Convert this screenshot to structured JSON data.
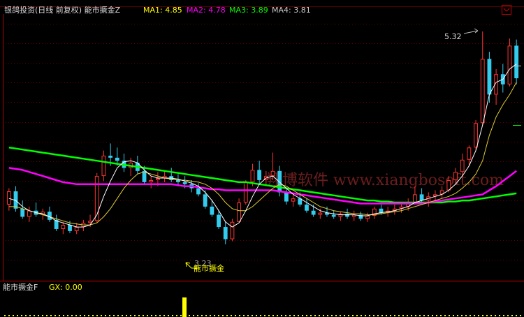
{
  "watermark": "翔博软件  www.xiangbosoft.com",
  "colors": {
    "up": "#ff3333",
    "down": "#33ccee",
    "ma1": "#ffffff",
    "ma2": "#ff00ff",
    "ma3": "#00ff00",
    "ma4": "#cccccc",
    "yellow_line": "#ddcc33",
    "title": "#dddddd",
    "signal": "#ffff00",
    "grid": "#660000"
  },
  "chart_data": {
    "type": "candlestick",
    "title": "银鸽投资(日线 前复权) 能市撅金Z",
    "legend": [
      {
        "label": "MA1:",
        "value": "4.85",
        "color": "#ffff00"
      },
      {
        "label": "MA2:",
        "value": "4.78",
        "color": "#ff00ff"
      },
      {
        "label": "MA3:",
        "value": "3.89",
        "color": "#00ff00"
      },
      {
        "label": "MA4:",
        "value": "3.81",
        "color": "#cccccc"
      }
    ],
    "sub_indicator": {
      "title": "能市撅金F",
      "label": "GX:",
      "value": "0.00",
      "color": "#ffff00"
    },
    "annotations": {
      "high_label": "5.32",
      "low_label": "3.23",
      "signal_label": "能市撅金"
    },
    "left_axis_mark": "",
    "grid_y": [
      34,
      62,
      90,
      118,
      146,
      175,
      203,
      231,
      259,
      287,
      316,
      344,
      372
    ],
    "y_range": [
      2.9,
      5.45
    ],
    "candles": [
      [
        3.62,
        3.78,
        3.56,
        3.75
      ],
      [
        3.75,
        3.8,
        3.55,
        3.58
      ],
      [
        3.58,
        3.66,
        3.48,
        3.5
      ],
      [
        3.5,
        3.6,
        3.45,
        3.56
      ],
      [
        3.56,
        3.64,
        3.5,
        3.52
      ],
      [
        3.52,
        3.58,
        3.47,
        3.55
      ],
      [
        3.55,
        3.6,
        3.45,
        3.47
      ],
      [
        3.47,
        3.52,
        3.36,
        3.38
      ],
      [
        3.38,
        3.45,
        3.33,
        3.42
      ],
      [
        3.42,
        3.46,
        3.34,
        3.36
      ],
      [
        3.36,
        3.44,
        3.33,
        3.4
      ],
      [
        3.4,
        3.47,
        3.36,
        3.44
      ],
      [
        3.44,
        3.52,
        3.4,
        3.46
      ],
      [
        3.46,
        3.93,
        3.44,
        3.9
      ],
      [
        3.9,
        4.15,
        3.85,
        4.1
      ],
      [
        4.1,
        4.22,
        4.0,
        4.08
      ],
      [
        4.08,
        4.18,
        4.0,
        4.05
      ],
      [
        4.05,
        4.12,
        3.94,
        3.98
      ],
      [
        3.98,
        4.08,
        3.9,
        4.03
      ],
      [
        4.03,
        4.1,
        3.92,
        3.95
      ],
      [
        3.95,
        4.0,
        3.82,
        3.84
      ],
      [
        3.84,
        3.9,
        3.78,
        3.86
      ],
      [
        3.86,
        3.94,
        3.8,
        3.88
      ],
      [
        3.88,
        3.95,
        3.84,
        3.9
      ],
      [
        3.9,
        3.98,
        3.84,
        3.86
      ],
      [
        3.86,
        3.92,
        3.8,
        3.84
      ],
      [
        3.84,
        3.9,
        3.78,
        3.82
      ],
      [
        3.82,
        3.86,
        3.74,
        3.78
      ],
      [
        3.78,
        3.83,
        3.7,
        3.72
      ],
      [
        3.72,
        3.76,
        3.58,
        3.6
      ],
      [
        3.6,
        3.66,
        3.5,
        3.52
      ],
      [
        3.52,
        3.56,
        3.38,
        3.4
      ],
      [
        3.4,
        3.45,
        3.23,
        3.28
      ],
      [
        3.28,
        3.48,
        3.26,
        3.45
      ],
      [
        3.45,
        3.68,
        3.44,
        3.64
      ],
      [
        3.64,
        3.86,
        3.62,
        3.84
      ],
      [
        3.84,
        4.02,
        3.8,
        3.96
      ],
      [
        3.96,
        4.05,
        3.82,
        3.86
      ],
      [
        3.86,
        3.95,
        3.8,
        3.9
      ],
      [
        3.9,
        4.13,
        3.86,
        3.95
      ],
      [
        3.95,
        4.0,
        3.7,
        3.74
      ],
      [
        3.74,
        3.78,
        3.62,
        3.65
      ],
      [
        3.65,
        3.72,
        3.6,
        3.68
      ],
      [
        3.68,
        3.74,
        3.6,
        3.62
      ],
      [
        3.62,
        3.68,
        3.54,
        3.56
      ],
      [
        3.56,
        3.62,
        3.5,
        3.52
      ],
      [
        3.52,
        3.58,
        3.48,
        3.54
      ],
      [
        3.54,
        3.6,
        3.5,
        3.52
      ],
      [
        3.52,
        3.56,
        3.48,
        3.5
      ],
      [
        3.5,
        3.55,
        3.46,
        3.53
      ],
      [
        3.53,
        3.58,
        3.48,
        3.5
      ],
      [
        3.5,
        3.56,
        3.46,
        3.52
      ],
      [
        3.52,
        3.55,
        3.46,
        3.48
      ],
      [
        3.48,
        3.54,
        3.45,
        3.51
      ],
      [
        3.51,
        3.6,
        3.48,
        3.58
      ],
      [
        3.58,
        3.62,
        3.52,
        3.54
      ],
      [
        3.54,
        3.6,
        3.5,
        3.56
      ],
      [
        3.56,
        3.62,
        3.52,
        3.58
      ],
      [
        3.58,
        3.64,
        3.54,
        3.6
      ],
      [
        3.6,
        3.68,
        3.56,
        3.64
      ],
      [
        3.64,
        3.8,
        3.62,
        3.72
      ],
      [
        3.72,
        3.78,
        3.62,
        3.66
      ],
      [
        3.66,
        3.74,
        3.6,
        3.7
      ],
      [
        3.7,
        3.76,
        3.64,
        3.72
      ],
      [
        3.72,
        3.8,
        3.68,
        3.76
      ],
      [
        3.76,
        3.9,
        3.74,
        3.86
      ],
      [
        3.86,
        3.98,
        3.82,
        3.94
      ],
      [
        3.94,
        4.12,
        3.9,
        4.06
      ],
      [
        4.06,
        4.2,
        4.0,
        4.18
      ],
      [
        4.18,
        4.45,
        4.15,
        4.42
      ],
      [
        4.42,
        5.32,
        4.4,
        5.05
      ],
      [
        5.05,
        5.12,
        4.62,
        4.7
      ],
      [
        4.7,
        4.95,
        4.6,
        4.9
      ],
      [
        4.9,
        5.0,
        4.72,
        4.8
      ],
      [
        4.8,
        5.25,
        4.78,
        5.18
      ],
      [
        5.18,
        5.24,
        4.8,
        4.86
      ]
    ],
    "ma_lines": {
      "ma3": [
        4.18,
        4.17,
        4.16,
        4.15,
        4.14,
        4.13,
        4.12,
        4.11,
        4.1,
        4.09,
        4.08,
        4.07,
        4.06,
        4.05,
        4.04,
        4.03,
        4.02,
        4.01,
        4.0,
        3.99,
        3.98,
        3.97,
        3.96,
        3.95,
        3.94,
        3.93,
        3.92,
        3.91,
        3.9,
        3.89,
        3.88,
        3.87,
        3.86,
        3.85,
        3.84,
        3.84,
        3.83,
        3.82,
        3.81,
        3.8,
        3.79,
        3.78,
        3.77,
        3.76,
        3.75,
        3.74,
        3.73,
        3.72,
        3.71,
        3.7,
        3.69,
        3.68,
        3.67,
        3.66,
        3.66,
        3.65,
        3.65,
        3.64,
        3.64,
        3.64,
        3.64,
        3.64,
        3.64,
        3.64,
        3.64,
        3.65,
        3.65,
        3.66,
        3.66,
        3.67,
        3.68,
        3.69,
        3.7,
        3.71,
        3.72,
        3.73
      ],
      "ma2": [
        3.98,
        3.97,
        3.96,
        3.94,
        3.92,
        3.9,
        3.88,
        3.86,
        3.84,
        3.83,
        3.82,
        3.82,
        3.82,
        3.82,
        3.82,
        3.82,
        3.82,
        3.82,
        3.82,
        3.82,
        3.82,
        3.82,
        3.82,
        3.82,
        3.82,
        3.81,
        3.8,
        3.8,
        3.79,
        3.78,
        3.77,
        3.77,
        3.76,
        3.76,
        3.76,
        3.76,
        3.76,
        3.76,
        3.76,
        3.76,
        3.75,
        3.74,
        3.73,
        3.72,
        3.71,
        3.7,
        3.69,
        3.68,
        3.67,
        3.66,
        3.65,
        3.64,
        3.63,
        3.63,
        3.63,
        3.63,
        3.63,
        3.63,
        3.63,
        3.63,
        3.63,
        3.63,
        3.64,
        3.65,
        3.66,
        3.67,
        3.68,
        3.69,
        3.7,
        3.71,
        3.72,
        3.76,
        3.8,
        3.85,
        3.9,
        3.95
      ],
      "ma1": [
        3.68,
        3.66,
        3.6,
        3.56,
        3.54,
        3.53,
        3.5,
        3.46,
        3.44,
        3.42,
        3.4,
        3.4,
        3.42,
        3.52,
        3.7,
        3.85,
        3.98,
        4.04,
        4.05,
        4.03,
        3.96,
        3.9,
        3.88,
        3.88,
        3.88,
        3.87,
        3.85,
        3.83,
        3.8,
        3.74,
        3.66,
        3.56,
        3.45,
        3.4,
        3.44,
        3.56,
        3.7,
        3.82,
        3.88,
        3.9,
        3.84,
        3.78,
        3.72,
        3.68,
        3.64,
        3.6,
        3.56,
        3.54,
        3.53,
        3.52,
        3.52,
        3.52,
        3.51,
        3.51,
        3.53,
        3.54,
        3.55,
        3.56,
        3.58,
        3.6,
        3.64,
        3.66,
        3.68,
        3.7,
        3.72,
        3.76,
        3.82,
        3.9,
        4.0,
        4.15,
        4.4,
        4.7,
        4.82,
        4.85,
        4.95,
        5.0
      ],
      "yellow": [
        3.6,
        3.6,
        3.58,
        3.56,
        3.54,
        3.52,
        3.5,
        3.48,
        3.46,
        3.44,
        3.43,
        3.42,
        3.42,
        3.44,
        3.5,
        3.58,
        3.68,
        3.78,
        3.86,
        3.92,
        3.94,
        3.92,
        3.9,
        3.88,
        3.87,
        3.86,
        3.86,
        3.85,
        3.84,
        3.82,
        3.78,
        3.72,
        3.64,
        3.58,
        3.56,
        3.56,
        3.6,
        3.66,
        3.72,
        3.78,
        3.82,
        3.8,
        3.76,
        3.72,
        3.68,
        3.64,
        3.6,
        3.58,
        3.56,
        3.55,
        3.54,
        3.53,
        3.53,
        3.52,
        3.52,
        3.53,
        3.54,
        3.55,
        3.56,
        3.58,
        3.6,
        3.62,
        3.64,
        3.66,
        3.68,
        3.7,
        3.73,
        3.78,
        3.84,
        3.92,
        4.05,
        4.3,
        4.48,
        4.6,
        4.7,
        4.82
      ]
    }
  }
}
